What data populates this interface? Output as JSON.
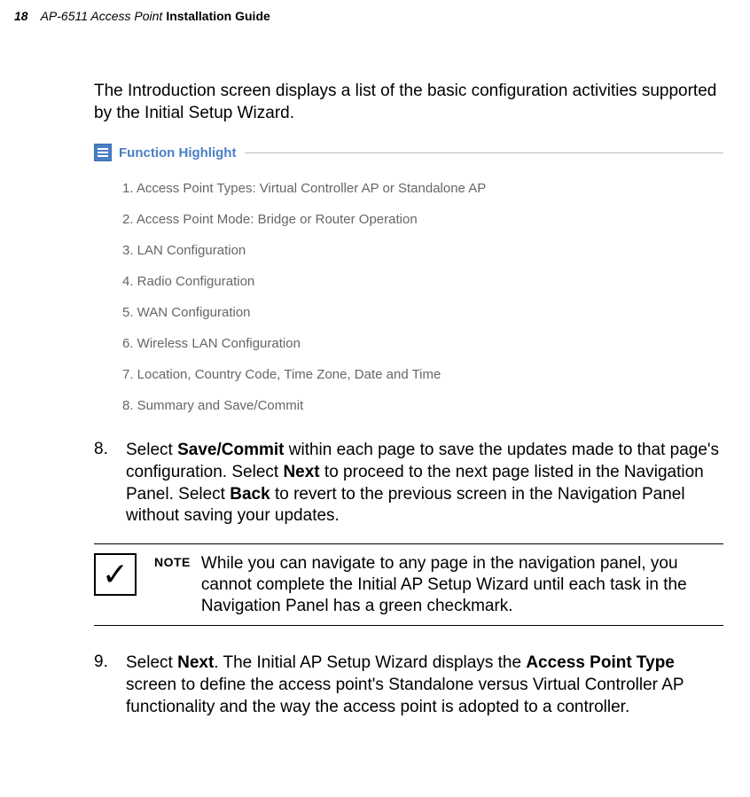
{
  "header": {
    "page_number": "18",
    "doc_title_italic": "AP-6511 Access Point",
    "doc_title_bold": "Installation Guide"
  },
  "intro_paragraph": "The Introduction screen displays a list of the basic configuration activities supported by the Initial Setup Wizard.",
  "function_highlight": {
    "title": "Function Highlight",
    "items": [
      "1. Access Point Types: Virtual Controller AP or Standalone AP",
      "2. Access Point Mode: Bridge or Router Operation",
      "3. LAN Configuration",
      "4. Radio Configuration",
      "5. WAN Configuration",
      "6. Wireless LAN Configuration",
      "7. Location, Country Code, Time Zone, Date and Time",
      "8. Summary and Save/Commit"
    ]
  },
  "step8": {
    "number": "8.",
    "part1": "Select ",
    "bold1": "Save/Commit",
    "part2": " within each page to save the updates made to that page's configuration. Select ",
    "bold2": "Next",
    "part3": " to proceed to the next page listed in the Navigation Panel. Select ",
    "bold3": "Back",
    "part4": " to revert to the previous screen in the Navigation Panel without saving your updates."
  },
  "note": {
    "label": "NOTE",
    "text": "While you can navigate to any page in the navigation panel, you cannot complete the Initial AP Setup Wizard until each task in the Navigation Panel has a green checkmark."
  },
  "step9": {
    "number": "9.",
    "part1": "Select ",
    "bold1": "Next",
    "part2": ". The Initial AP Setup Wizard displays the ",
    "bold2": "Access Point Type",
    "part3": " screen to define the access point's Standalone versus Virtual Controller AP functionality and the way the access point is adopted to a controller."
  }
}
